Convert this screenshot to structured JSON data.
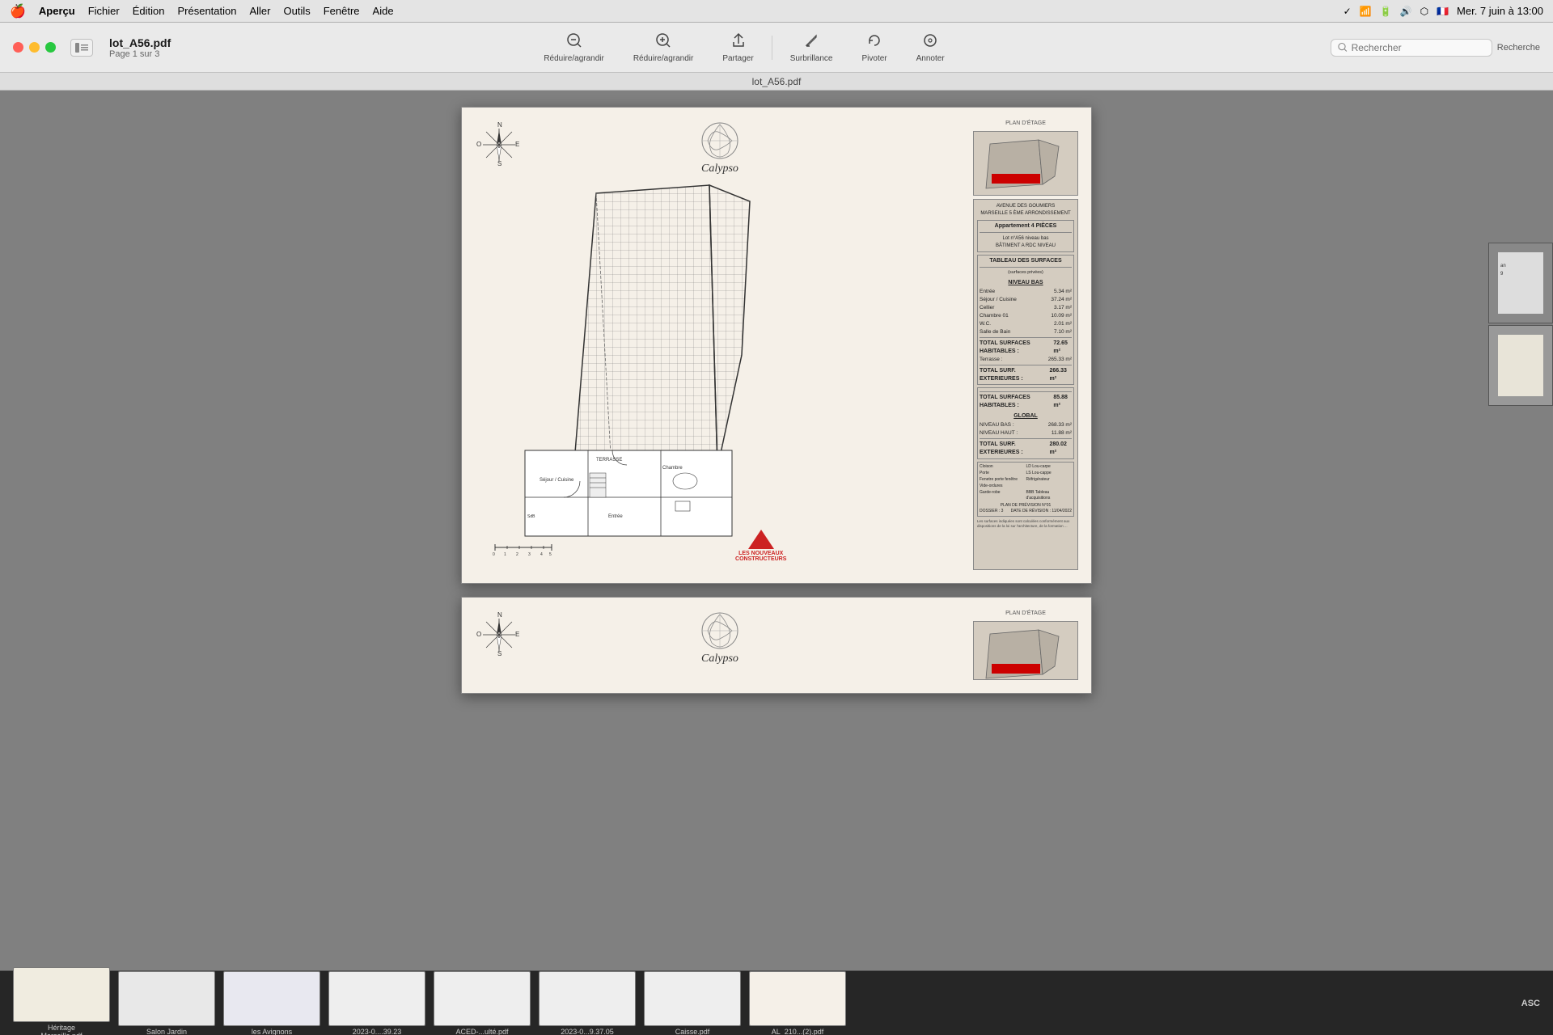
{
  "menubar": {
    "apple": "🍎",
    "items": [
      "Aperçu",
      "Fichier",
      "Édition",
      "Présentation",
      "Aller",
      "Outils",
      "Fenêtre",
      "Aide"
    ],
    "clock": "Mer. 7 juin à 13:00"
  },
  "toolbar": {
    "file_name": "lot_A56.pdf",
    "file_pages": "Page 1 sur 3",
    "title": "lot_A56.pdf",
    "buttons": [
      {
        "label": "Réduire/agrandir",
        "icon": "⊕"
      },
      {
        "label": "Réduire/agrandir",
        "icon": "⊖"
      },
      {
        "label": "Partager",
        "icon": "↑"
      },
      {
        "label": "Surbrillance",
        "icon": "✏️"
      },
      {
        "label": "Pivoter",
        "icon": "↻"
      },
      {
        "label": "Annoter",
        "icon": "◎"
      }
    ],
    "search_placeholder": "Rechercher",
    "search_label": "Recherche"
  },
  "page1": {
    "calypso_label": "Calypso",
    "plan_label": "PLAN D'ÉTAGE",
    "address_line1": "AVENUE DES GOUMIERS",
    "address_line2": "MARSEILLE 5 ÈME ARRONDISSEMENT",
    "apt_title": "Appartement  4 PIÈCES",
    "lot_info": "Lot n°A56 niveau bas",
    "bat_info": "BÂTIMENT  A  RDC NIVEAU",
    "table_title": "TABLEAU DES SURFACES",
    "table_sub": "(surfaces privées)",
    "niveau_bas": "NIVEAU BAS",
    "rooms": [
      {
        "name": "Entrée",
        "value": "5.34 m²"
      },
      {
        "name": "Séjour / Cuisine",
        "value": "37.24 m²"
      },
      {
        "name": "Cellier",
        "value": "3.17 m²"
      },
      {
        "name": "Chambre 01",
        "value": "10.09 m²"
      },
      {
        "name": "W.C.",
        "value": "2.01 m²"
      },
      {
        "name": "Salle de Bain",
        "value": "7.10 m²"
      }
    ],
    "total_hab_label": "TOTAL SURFACES HABITABLES :",
    "total_hab_value": "72.65 m²",
    "terrasse_label": "Terrasse :",
    "terrasse_value": "265.33 m²",
    "total_ext_label": "TOTAL SURF. EXTERIEURES :",
    "total_ext_value": "266.33 m²",
    "total_hab2_label": "TOTAL SURFACES HABITABLES :",
    "total_hab2_value": "85.88 m²",
    "global_label": "GLOBAL",
    "niveau_bas_total": "268.33 m²",
    "niveau_haut_total": "11.88 m²",
    "total_surf_ext_label": "TOTAL SURF. EXTERIEURES :",
    "total_surf_ext_value": "280.02 m²",
    "terrace_label": "TERRASSE",
    "sejour_label": "Séjour / Cuisine",
    "chambre_label": "Chambre",
    "entree_label": "Entrée",
    "scale_numbers": "0  1  2  3  4  5",
    "lnc_line1": "LES NOUVEAUX",
    "lnc_line2": "CONSTRUCTEURS",
    "date_label": "11/04/2022"
  },
  "page2": {
    "calypso_label": "Calypso"
  },
  "taskbar": {
    "items": [
      {
        "label": "Héritage\nMarseille.pdf"
      },
      {
        "label": "Salon Jardin"
      },
      {
        "label": "les Avignons"
      },
      {
        "label": "2023-0....39.23"
      },
      {
        "label": "ACED-...ulté.pdf"
      },
      {
        "label": "2023-0...9.37.05"
      },
      {
        "label": "Caisse.pdf"
      },
      {
        "label": "AL_210...(2).pdf"
      }
    ],
    "asc_label": "ASC"
  }
}
